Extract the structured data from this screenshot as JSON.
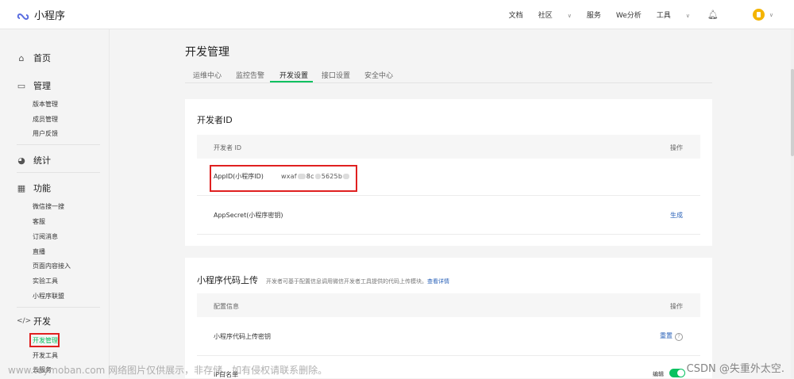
{
  "topbar": {
    "logo_text": "小程序",
    "nav": [
      "文档",
      "社区",
      "服务",
      "We分析",
      "工具"
    ]
  },
  "sidebar": {
    "home": "首页",
    "manage": "管理",
    "manage_items": [
      "版本管理",
      "成员管理",
      "用户反馈"
    ],
    "stats": "统计",
    "features": "功能",
    "feature_items": [
      "微信搜一搜",
      "客服",
      "订阅消息",
      "直播",
      "页面内容接入",
      "实验工具",
      "小程序联盟"
    ],
    "develop": "开发",
    "develop_items": [
      "开发管理",
      "开发工具",
      "云服务"
    ]
  },
  "page": {
    "title": "开发管理",
    "tabs": [
      "运维中心",
      "监控告警",
      "开发设置",
      "接口设置",
      "安全中心"
    ]
  },
  "developer_id": {
    "title": "开发者ID",
    "col_left": "开发者 ID",
    "col_right": "操作",
    "appid_label": "AppID(小程序ID)",
    "appid_prefix": "wxaf",
    "appid_mid": "8c",
    "appid_suffix": "5625b",
    "secret_label": "AppSecret(小程序密钥)",
    "secret_action": "生成"
  },
  "upload": {
    "title": "小程序代码上传",
    "hint": "开发者可基于配置信息调用微信开发者工具提供的代码上传模块。",
    "hint_link": "查看详情",
    "col_left": "配置信息",
    "col_right": "操作",
    "key_label": "小程序代码上传密钥",
    "key_action": "重置",
    "ip_label": "IP白名单",
    "ip_action": "编辑"
  },
  "watermark": "www.toymoban.com 网络图片仅供展示，非存储，如有侵权请联系删除。",
  "csdn": "CSDN @失重外太空."
}
